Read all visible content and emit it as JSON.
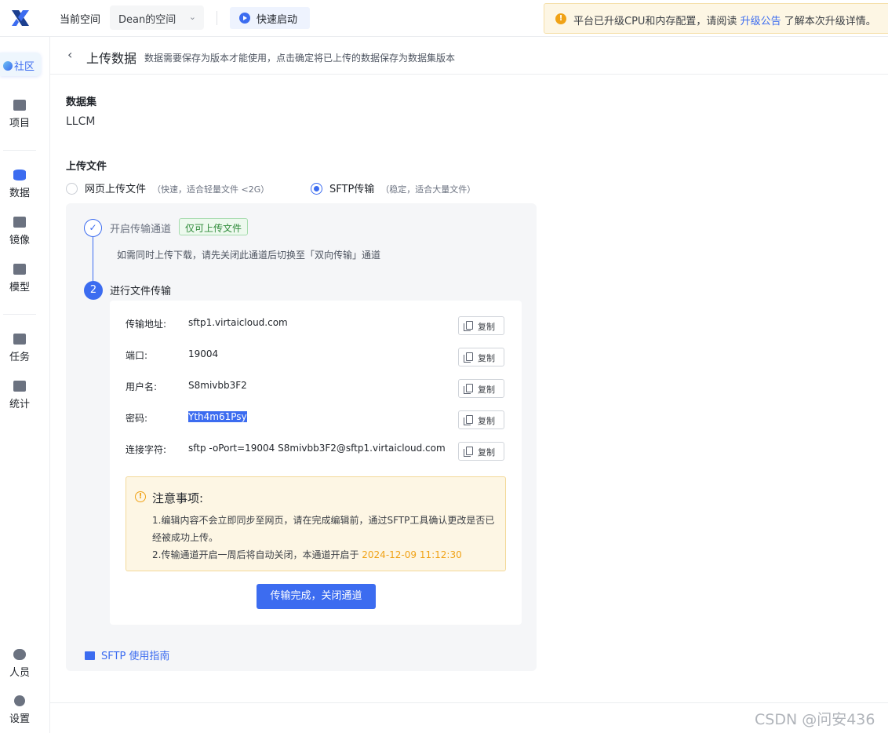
{
  "topbar": {
    "space_label": "当前空间",
    "space_value": "Dean的空间",
    "quick_start": "快速启动",
    "notice_text": "平台已升级CPU和内存配置，请阅读",
    "notice_link": "升级公告",
    "notice_tail": "了解本次升级详情。"
  },
  "sidebar": {
    "community": "社区",
    "items": [
      {
        "label": "项目",
        "icon": "folder-icon"
      },
      {
        "label": "数据",
        "icon": "database-icon"
      },
      {
        "label": "镜像",
        "icon": "image-icon"
      },
      {
        "label": "模型",
        "icon": "model-icon"
      },
      {
        "label": "任务",
        "icon": "task-icon"
      },
      {
        "label": "统计",
        "icon": "stats-icon"
      },
      {
        "label": "人员",
        "icon": "people-icon"
      },
      {
        "label": "设置",
        "icon": "gear-icon"
      }
    ]
  },
  "page": {
    "title": "上传数据",
    "subtitle": "数据需要保存为版本才能使用，点击确定将已上传的数据保存为数据集版本",
    "dataset_label": "数据集",
    "dataset_value": "LLCM",
    "upload_label": "上传文件"
  },
  "upload_options": {
    "web": {
      "label": "网页上传文件",
      "hint": "（快速，适合轻量文件 <2G）",
      "selected": false
    },
    "sftp": {
      "label": "SFTP传输",
      "hint": "（稳定，适合大量文件）",
      "selected": true
    }
  },
  "steps": {
    "step1_title": "开启传输通道",
    "step1_tag": "仅可上传文件",
    "step1_desc": "如需同时上传下载，请先关闭此通道后切换至「双向传输」通道",
    "step2_number": "2",
    "step2_title": "进行文件传输"
  },
  "connection": [
    {
      "label": "传输地址:",
      "value": "sftp1.virtaicloud.com"
    },
    {
      "label": "端口:",
      "value": "19004"
    },
    {
      "label": "用户名:",
      "value": "S8mivbb3F2"
    },
    {
      "label": "密码:",
      "value": "Yth4m61Psy"
    },
    {
      "label": "连接字符:",
      "value": "sftp -oPort=19004 S8mivbb3F2@sftp1.virtaicloud.com"
    }
  ],
  "copy_label": "复制",
  "attention": {
    "title": "注意事项:",
    "line1": "1.编辑内容不会立即同步至网页，请在完成编辑前，通过SFTP工具确认更改是否已",
    "line2": "经被成功上传。",
    "line3": "2.传输通道开启一周后将自动关闭，本通道开启于",
    "timestamp": "2024-12-09 11:12:30"
  },
  "close_button": "传输完成，关闭通道",
  "guide_link": "SFTP 使用指南",
  "watermark": "CSDN @问安436",
  "colors": {
    "accent": "#3c6cf0",
    "warning": "#f0a216",
    "success": "#2f8b3a"
  }
}
